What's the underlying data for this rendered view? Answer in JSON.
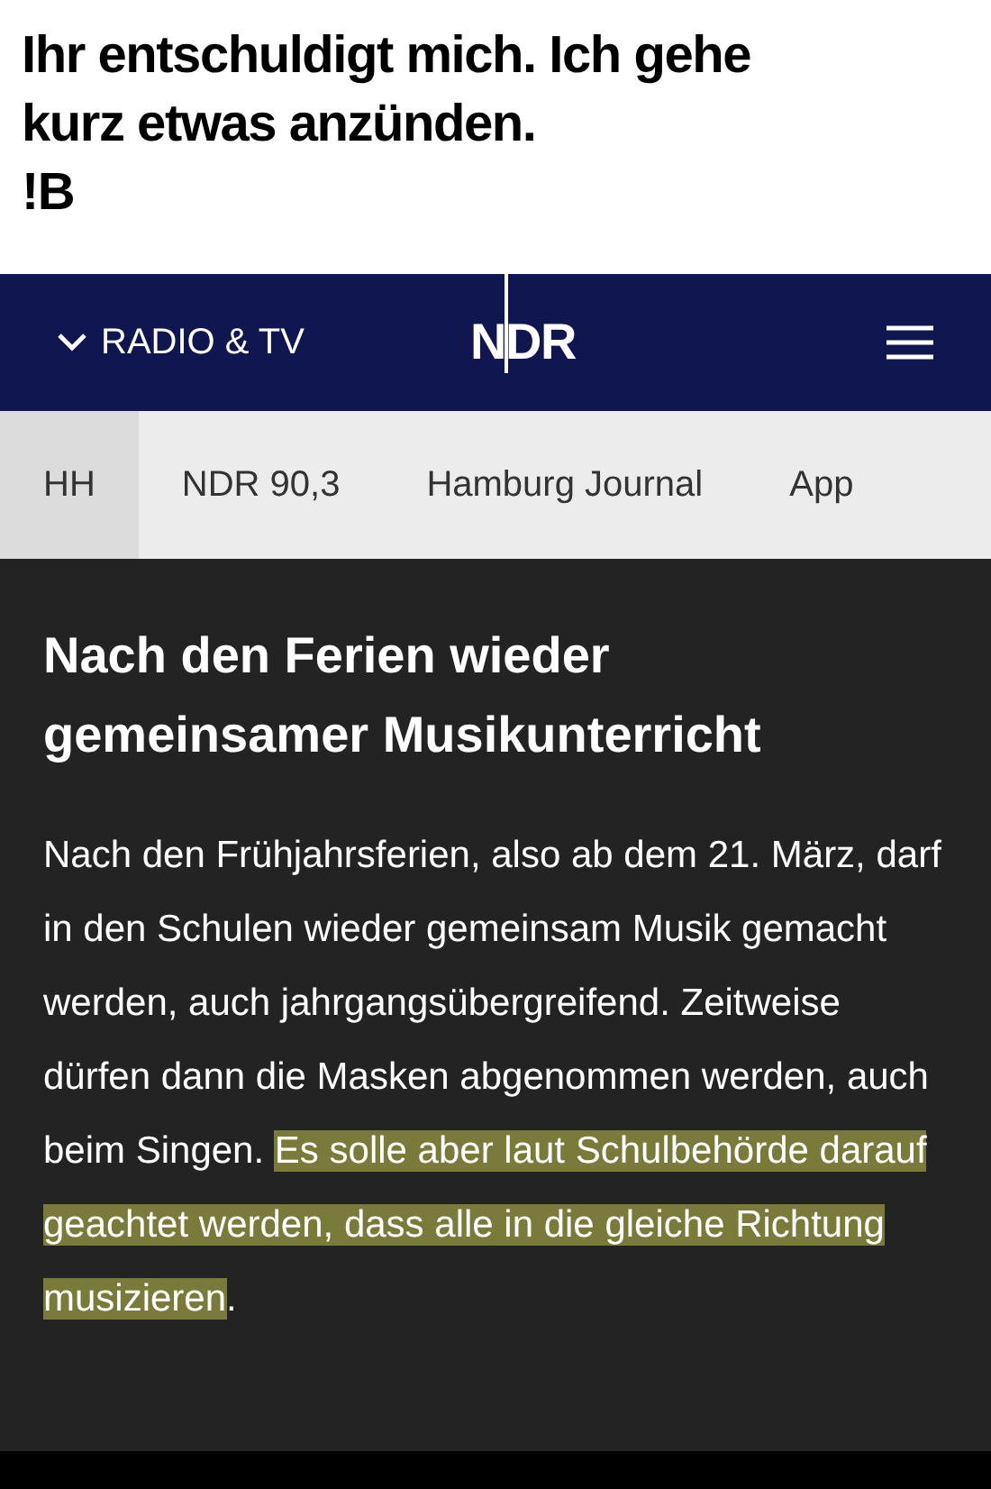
{
  "caption": {
    "lines": [
      "Ihr entschuldigt mich. Ich gehe",
      "kurz etwas anzünden.",
      "!B"
    ]
  },
  "header": {
    "menu_label": "RADIO & TV",
    "logo": "NDR"
  },
  "nav_tabs": [
    {
      "label": "HH",
      "selected": true
    },
    {
      "label": "NDR 90,3",
      "selected": false
    },
    {
      "label": "Hamburg Journal",
      "selected": false
    },
    {
      "label": "App",
      "selected": false
    }
  ],
  "article": {
    "headline": "Nach den Ferien wieder gemeinsamer Musikunterricht",
    "body": "Nach den Frühjahrsferien, also ab dem 21. März, darf in den Schulen wieder gemeinsam Musik gemacht werden, auch jahrgangsübergreifend. Zeitweise dürfen dann die Masken abgenommen werden, auch beim Singen. ",
    "highlighted": "Es solle aber laut Schulbehörde darauf geachtet werden, dass alle in die gleiche Richtung musizieren",
    "tail": "."
  }
}
